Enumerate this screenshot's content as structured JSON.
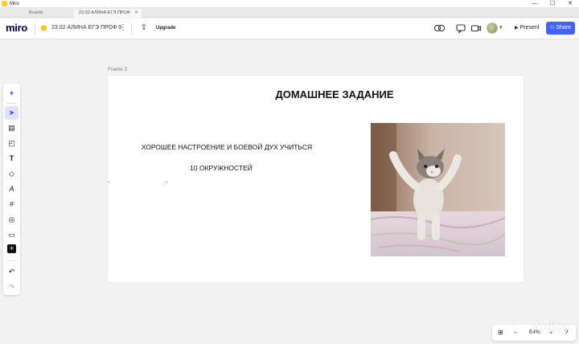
{
  "window": {
    "app_title": "Miro",
    "controls": [
      "—",
      "☐",
      "✕"
    ]
  },
  "tabs": [
    {
      "label": "Boards"
    },
    {
      "label": "23.02 АЛИНА ЕГЭ ПРОФ",
      "close": "✕"
    }
  ],
  "toolbar": {
    "logo": "miro",
    "board_name": "23.02 АЛИНА ЕГЭ ПРОФ 9",
    "more": "⋮",
    "share_icon": "⇪",
    "upgrade": "Upgrade",
    "right_icons": [
      "reactions-icon",
      "comment-icon",
      "video-icon"
    ],
    "present": "Present",
    "share": "Share"
  },
  "canvas": {
    "frame_label": "Frame 2",
    "heading": "ДОМАШНЕЕ ЗАДАНИЕ",
    "line1": "ХОРОШЕЕ НАСТРОЕНИЕ И БОЕВОЙ ДУХ УЧИТЬСЯ",
    "line2": "10 ОКРУЖНОСТЕЙ",
    "image": "kitten-photo"
  },
  "rail": {
    "tools": [
      {
        "name": "ai-sparkle-icon",
        "glyph": "✦"
      },
      {
        "name": "select-icon",
        "glyph": "➤"
      },
      {
        "name": "templates-icon",
        "glyph": "▤"
      },
      {
        "name": "sticky-note-icon",
        "glyph": "◰"
      },
      {
        "name": "text-icon",
        "glyph": "T"
      },
      {
        "name": "shapes-icon",
        "glyph": "◇"
      },
      {
        "name": "pen-icon",
        "glyph": "A"
      },
      {
        "name": "frame-icon",
        "glyph": "#"
      },
      {
        "name": "sticker-icon",
        "glyph": "◎"
      },
      {
        "name": "comment-icon",
        "glyph": "▭"
      },
      {
        "name": "add-icon",
        "glyph": "+"
      },
      {
        "name": "undo-icon",
        "glyph": "↶"
      },
      {
        "name": "redo-icon",
        "glyph": "↷"
      }
    ]
  },
  "zoom": {
    "minus": "−",
    "level": "64%",
    "plus": "+",
    "help": "?"
  },
  "watermark": "Avito",
  "colors": {
    "accent": "#4262ff",
    "logo": "#050038",
    "board_icon": "#ffc21a"
  }
}
